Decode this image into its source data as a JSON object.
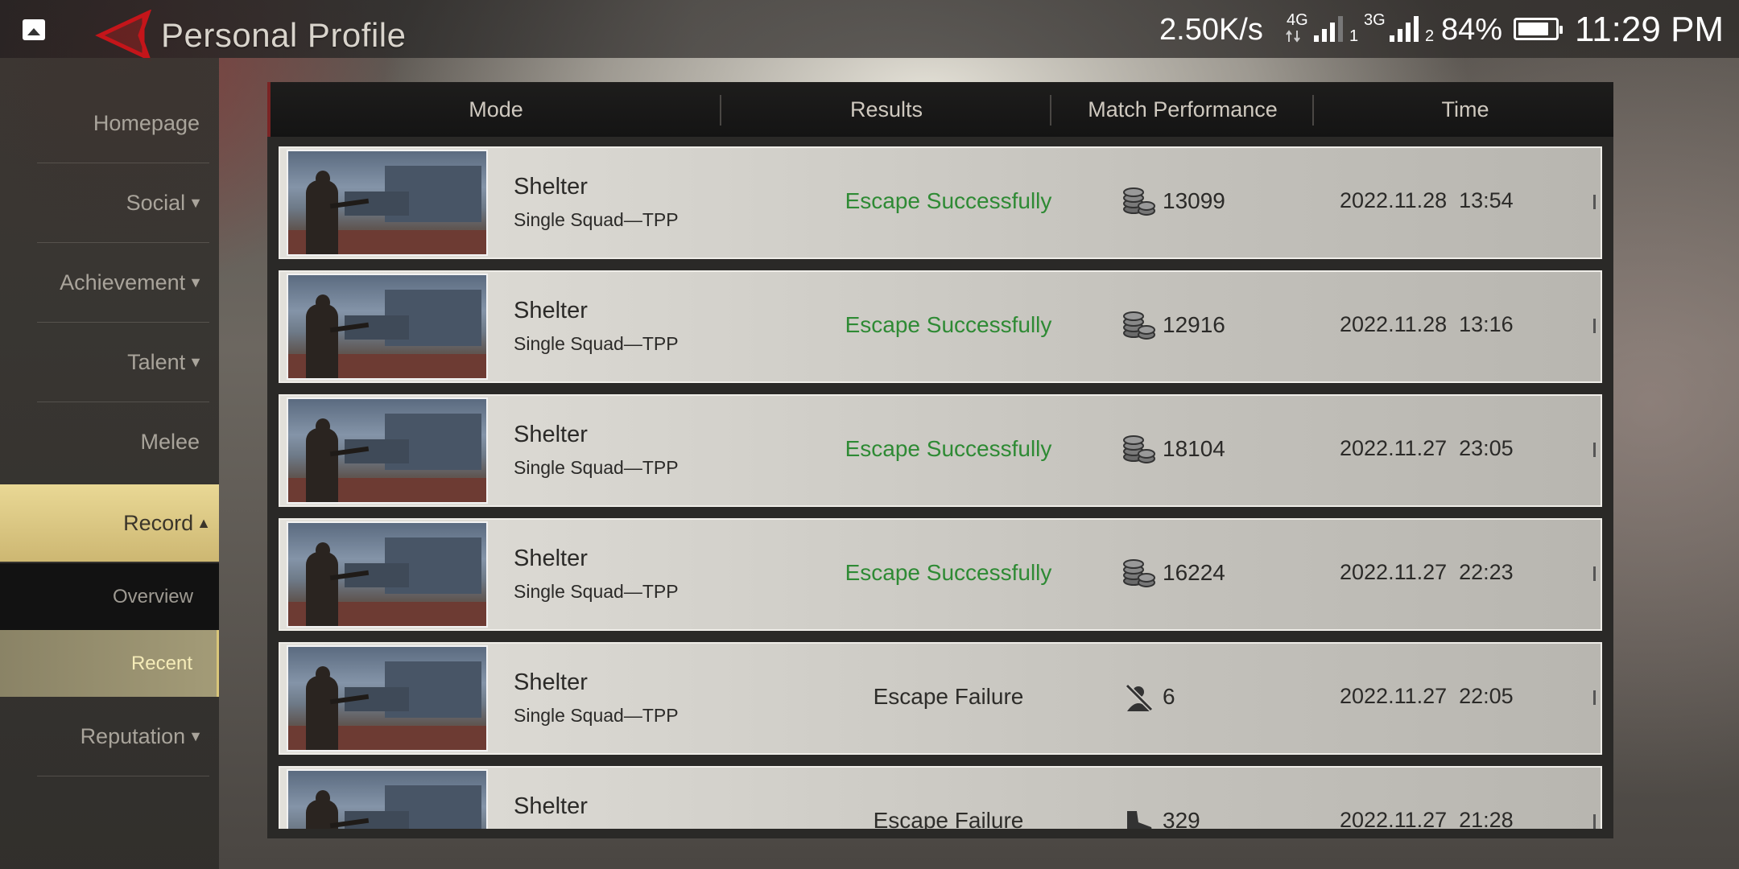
{
  "status_bar": {
    "net_speed": "2.50K/s",
    "sim1_type": "4G",
    "sim1_slot": "1",
    "sim2_type": "3G",
    "sim2_slot": "2",
    "battery_pct": "84%",
    "battery_level": 0.84,
    "clock": "11:29 PM",
    "icons": [
      "gallery-icon",
      "signal-icon",
      "battery-icon"
    ]
  },
  "header": {
    "title": "Personal Profile",
    "back_icon": "back-arrow-icon"
  },
  "sidebar": {
    "items": [
      {
        "label": "Homepage",
        "caret": ""
      },
      {
        "label": "Social",
        "caret": "▼"
      },
      {
        "label": "Achievement",
        "caret": "▼"
      },
      {
        "label": "Talent",
        "caret": "▼"
      },
      {
        "label": "Melee",
        "caret": ""
      },
      {
        "label": "Record",
        "caret": "▲"
      },
      {
        "label": "Reputation",
        "caret": "▼"
      }
    ],
    "sub_items": [
      {
        "label": "Overview"
      },
      {
        "label": "Recent"
      }
    ],
    "active_color": "#e9d895"
  },
  "table": {
    "headers": [
      "Mode",
      "Results",
      "Match Performance",
      "Time"
    ],
    "rows": [
      {
        "map": "Shelter",
        "mode": "Single Squad—TPP",
        "result": "Escape Successfully",
        "status": "success",
        "perf_icon": "coins-icon",
        "perf": "13099",
        "time": "2022.11.28  13:54"
      },
      {
        "map": "Shelter",
        "mode": "Single Squad—TPP",
        "result": "Escape Successfully",
        "status": "success",
        "perf_icon": "coins-icon",
        "perf": "12916",
        "time": "2022.11.28  13:16"
      },
      {
        "map": "Shelter",
        "mode": "Single Squad—TPP",
        "result": "Escape Successfully",
        "status": "success",
        "perf_icon": "coins-icon",
        "perf": "18104",
        "time": "2022.11.27  23:05"
      },
      {
        "map": "Shelter",
        "mode": "Single Squad—TPP",
        "result": "Escape Successfully",
        "status": "success",
        "perf_icon": "coins-icon",
        "perf": "16224",
        "time": "2022.11.27  22:23"
      },
      {
        "map": "Shelter",
        "mode": "Single Squad—TPP",
        "result": "Escape Failure",
        "status": "fail",
        "perf_icon": "eliminated-icon",
        "perf": "6",
        "time": "2022.11.27  22:05"
      },
      {
        "map": "Shelter",
        "mode": "",
        "result": "Escape Failure",
        "status": "fail",
        "perf_icon": "boot-icon",
        "perf": "329",
        "time": "2022.11.27  21:28"
      }
    ],
    "success_color": "#2e8a34"
  }
}
